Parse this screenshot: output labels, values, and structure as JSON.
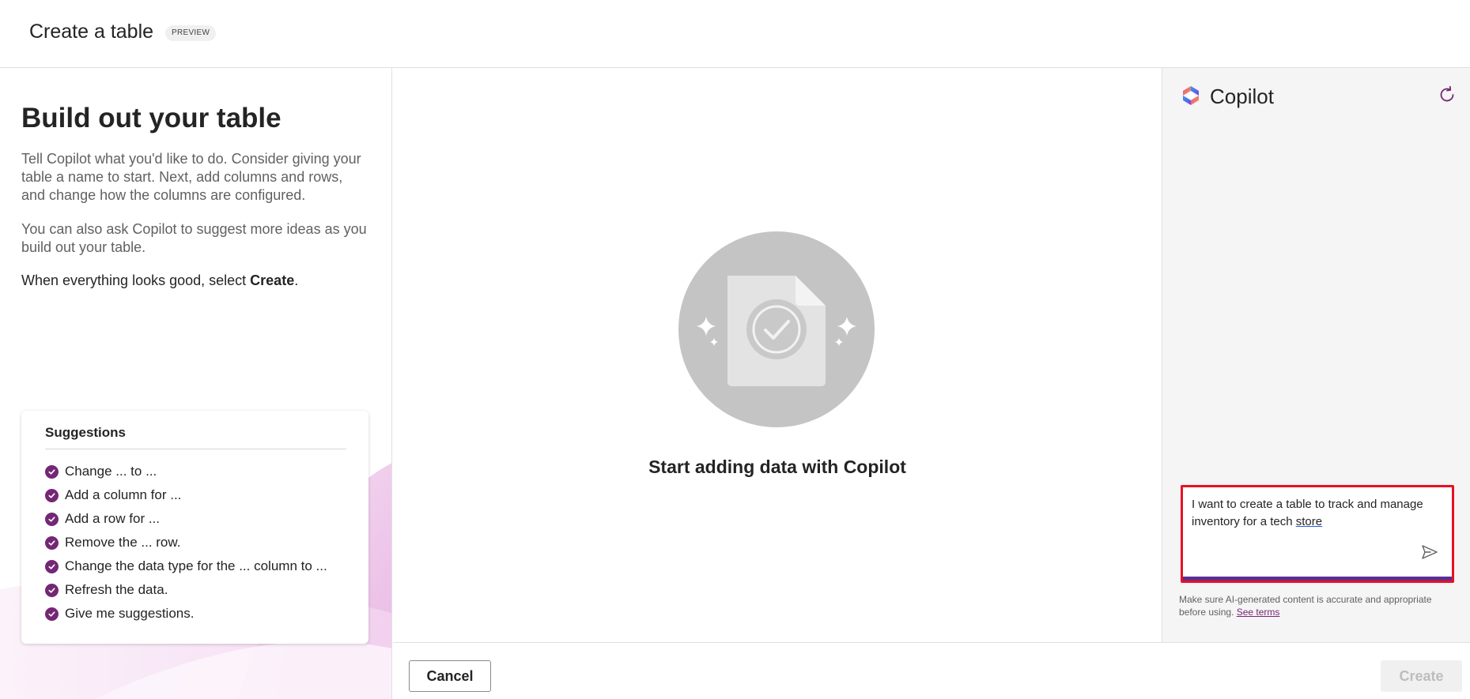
{
  "header": {
    "title": "Create a table",
    "badge": "PREVIEW"
  },
  "left_panel": {
    "heading": "Build out your table",
    "paragraph1": "Tell Copilot what you'd like to do. Consider giving your table a name to start. Next, add columns and rows, and change how the columns are configured.",
    "paragraph2": "You can also ask Copilot to suggest more ideas as you build out your table.",
    "paragraph3_prefix": "When everything looks good, select ",
    "paragraph3_bold": "Create",
    "paragraph3_suffix": ".",
    "suggestions": {
      "title": "Suggestions",
      "items": [
        "Change ... to ...",
        "Add a column for ...",
        "Add a row for ...",
        "Remove the ... row.",
        "Change the data type for the ... column to ...",
        "Refresh the data.",
        "Give me suggestions."
      ]
    }
  },
  "center": {
    "caption": "Start adding data with Copilot",
    "hero_icon": "document-check-icon"
  },
  "copilot": {
    "title": "Copilot",
    "refresh_icon": "refresh-icon",
    "input_text_prefix": "I want to create a table to track and manage inventory for a tech ",
    "input_text_underlined": "store",
    "send_icon": "send-icon",
    "disclaimer": "Make sure AI-generated content is accurate and appropriate before using.",
    "terms_link": "See terms"
  },
  "footer": {
    "cancel_label": "Cancel",
    "create_label": "Create"
  },
  "colors": {
    "accent_purple": "#742774",
    "highlight_red": "#e81123",
    "input_bar": "#5c2e91"
  }
}
